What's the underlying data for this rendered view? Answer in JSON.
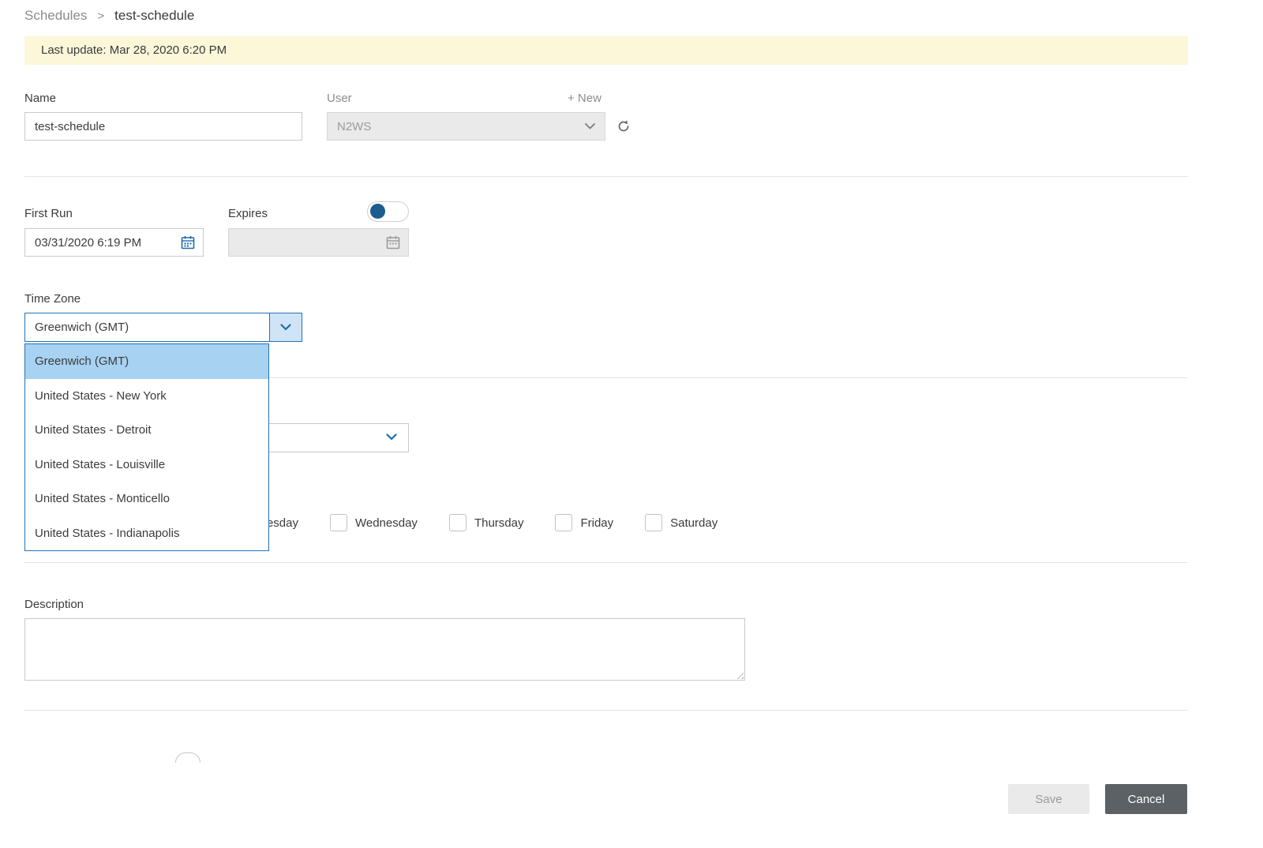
{
  "breadcrumb": {
    "parent": "Schedules",
    "separator": ">",
    "current": "test-schedule"
  },
  "notice": {
    "text": "Last update: Mar 28, 2020 6:20 PM"
  },
  "fields": {
    "name": {
      "label": "Name",
      "value": "test-schedule"
    },
    "user": {
      "label": "User",
      "value": "N2WS",
      "new_link": "+ New"
    },
    "first_run": {
      "label": "First Run",
      "value": "03/31/2020 6:19 PM"
    },
    "expires": {
      "label": "Expires",
      "value": ""
    },
    "time_zone": {
      "label": "Time Zone",
      "value": "Greenwich (GMT)"
    },
    "description": {
      "label": "Description",
      "value": ""
    }
  },
  "time_zone_options": [
    "Greenwich (GMT)",
    "United States - New York",
    "United States - Detroit",
    "United States - Louisville",
    "United States - Monticello",
    "United States - Indianapolis"
  ],
  "time_zone_selected_index": 0,
  "days": [
    "Tuesday",
    "Wednesday",
    "Thursday",
    "Friday",
    "Saturday"
  ],
  "footer": {
    "save_label": "Save",
    "cancel_label": "Cancel"
  },
  "colors": {
    "accent": "#2272b9",
    "highlight": "#a8d2f2",
    "chevron-box": "#cfe4f6",
    "notice-bg": "#fbf7d8",
    "disabled-bg": "#eaeaea",
    "toggle-knob": "#1d5c8f",
    "cancel-bg": "#5c6165"
  }
}
